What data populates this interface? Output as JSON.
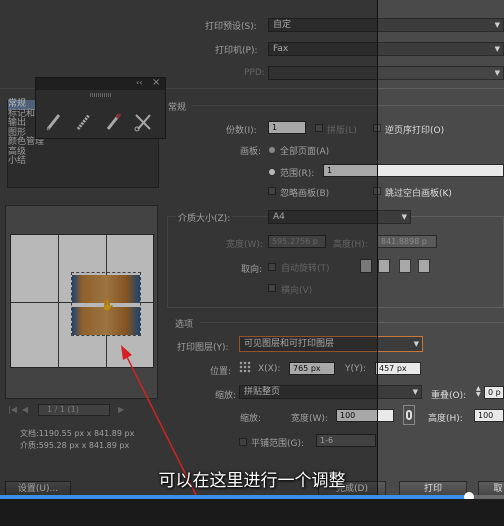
{
  "printer": {
    "preset_label": "打印预设(S):",
    "preset_value": "自定",
    "printer_label": "打印机(P):",
    "printer_value": "Fax",
    "ppd_label": "PPD:"
  },
  "sidebar": {
    "items": [
      {
        "label": "常规"
      },
      {
        "label": "标记和"
      },
      {
        "label": "输出"
      },
      {
        "label": "图形"
      },
      {
        "label": "颜色管理"
      },
      {
        "label": "高级"
      },
      {
        "label": "小结"
      }
    ]
  },
  "general": {
    "section_title": "常规",
    "copies_label": "份数(I):",
    "copies_value": "1",
    "collate_label": "拼版(L)",
    "reverse_label": "逆页序打印(O)",
    "artboards_label": "画板:",
    "all_pages_label": "全部页面(A)",
    "range_label": "范围(R):",
    "range_value": "1",
    "ignore_artboards_label": "忽略画板(B)",
    "skip_blank_label": "跳过空白画板(K)"
  },
  "media": {
    "size_label": "介质大小(Z):",
    "size_value": "A4",
    "width_label": "宽度(W):",
    "width_value": "595.2756 p",
    "height_label": "高度(H):",
    "height_value": "841.8898 p",
    "orientation_label": "取向:",
    "auto_rotate_label": "自动旋转(T)",
    "transverse_label": "横向(V)"
  },
  "options": {
    "section_title": "选项",
    "print_layers_label": "打印图层(Y):",
    "print_layers_value": "可见图层和可打印图层",
    "position_label": "位置:",
    "x_label": "X(X):",
    "x_value": "765 px",
    "y_label": "Y(Y):",
    "y_value": "457 px",
    "scaling_label": "缩放:",
    "scaling_value": "拼贴整页",
    "overlap_label": "重叠(O):",
    "overlap_value": "0 p",
    "zoom_label": "缩放:",
    "zoom_width_label": "宽度(W):",
    "zoom_width_value": "100",
    "zoom_height_label": "高度(H):",
    "zoom_height_value": "100",
    "tile_range_label": "平铺范围(G):",
    "tile_range_value": "1-6"
  },
  "preview": {
    "page_nav": "1 / 1 (1)",
    "doc_label": "文档:",
    "doc_value": "1190.55 px x 841.89 px",
    "media_label": "介质:",
    "media_value": "595.28 px x 841.89 px"
  },
  "toolbar": {
    "title_hint": "‹‹",
    "close_glyph": "×"
  },
  "buttons": {
    "setup_label": "设置(U)...",
    "done_label": "完成(D)",
    "print_label": "打印",
    "cancel_label": "取"
  },
  "subtitle": "可以在这里进行一个调整",
  "video": {
    "progress": 0.93
  },
  "colors": {
    "dialog_bg": "#4a4a4a",
    "accent_border": "#c8783a",
    "progress_bar": "#3a8ee6",
    "subtitle_text": "#ffffff",
    "annotation_arrow": "#d42020"
  }
}
